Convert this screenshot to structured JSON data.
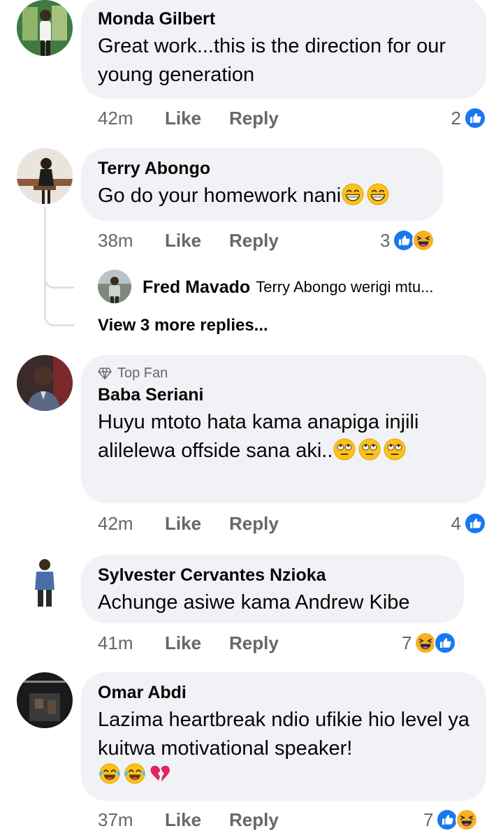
{
  "comments": [
    {
      "name": "Monda Gilbert",
      "text": "Great work...this is the direction for our young generation",
      "time": "42m",
      "like": "Like",
      "reply": "Reply",
      "count": "2",
      "reactions": [
        "like-icon"
      ]
    },
    {
      "name": "Terry Abongo",
      "text": "Go do your homework nani",
      "emojis": [
        "grinning-face-icon",
        "grinning-face-icon"
      ],
      "time": "38m",
      "like": "Like",
      "reply": "Reply",
      "count": "3",
      "reactions": [
        "like-icon",
        "haha-icon"
      ],
      "replies": {
        "name": "Fred Mavado",
        "text": "Terry Abongo werigi  mtu...",
        "more": "View 3 more replies..."
      }
    },
    {
      "badge": "Top Fan",
      "name": "Baba Seriani",
      "text": "Huyu mtoto hata kama anapiga injili alilelewa offside sana aki..",
      "emojis": [
        "eye-roll-icon",
        "eye-roll-icon",
        "eye-roll-icon"
      ],
      "time": "42m",
      "like": "Like",
      "reply": "Reply",
      "count": "4",
      "reactions": [
        "like-icon"
      ]
    },
    {
      "name": "Sylvester Cervantes Nzioka",
      "text": "Achunge asiwe kama Andrew Kibe",
      "time": "41m",
      "like": "Like",
      "reply": "Reply",
      "count": "7",
      "reactions": [
        "haha-icon",
        "like-icon"
      ]
    },
    {
      "name": "Omar Abdi",
      "text": "Lazima heartbreak ndio ufikie hio level ya kuitwa motivational speaker!",
      "emojis": [
        "tears-of-joy-icon",
        "tears-of-joy-icon",
        "broken-heart-icon"
      ],
      "time": "37m",
      "like": "Like",
      "reply": "Reply",
      "count": "7",
      "reactions": [
        "like-icon",
        "haha-icon"
      ]
    }
  ],
  "colors": {
    "bubble": "#f0f2f5",
    "meta_text": "#65676b",
    "like_blue": "#1877f2",
    "haha_yellow": "#f7b125"
  }
}
